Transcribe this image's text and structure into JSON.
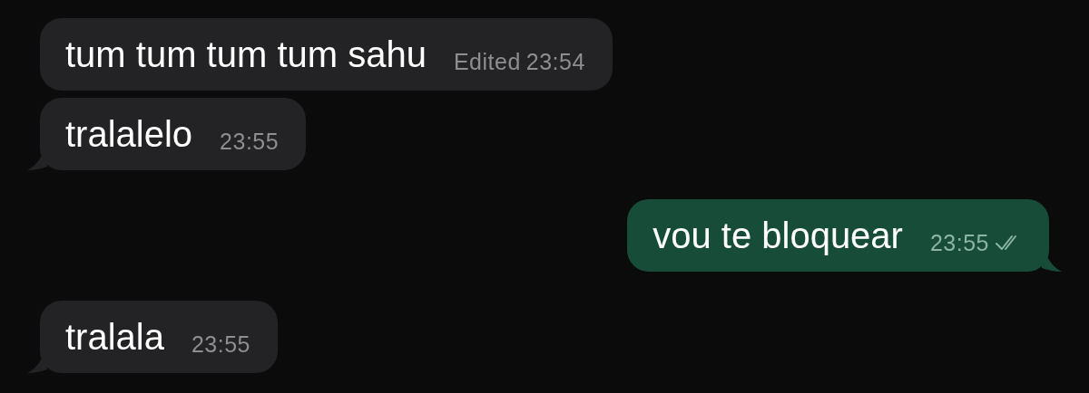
{
  "messages": [
    {
      "kind": "incoming",
      "text": "tum tum tum tum sahu",
      "edited_label": "Edited",
      "time": "23:54",
      "tail": false
    },
    {
      "kind": "incoming",
      "text": "tralalelo",
      "time": "23:55",
      "tail": true
    },
    {
      "kind": "outgoing",
      "text": "vou te bloquear",
      "time": "23:55",
      "tail": true,
      "read": true
    },
    {
      "kind": "incoming",
      "text": "tralala",
      "time": "23:55",
      "tail": true
    }
  ]
}
